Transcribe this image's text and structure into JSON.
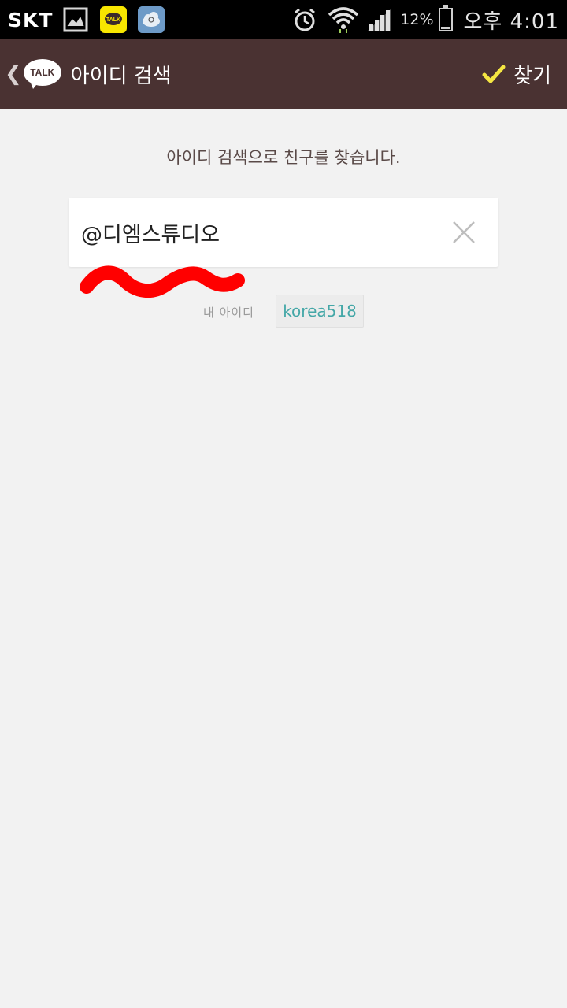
{
  "status_bar": {
    "carrier": "SKT",
    "battery_percent": "12%",
    "battery_level": 0.12,
    "time": "오후 4:01",
    "icons": [
      "gallery-icon",
      "kakaotalk-icon",
      "cloud-icon",
      "alarm-icon",
      "wifi-icon",
      "signal-icon",
      "battery-icon"
    ]
  },
  "header": {
    "logo_text": "TALK",
    "title": "아이디 검색",
    "find_label": "찾기",
    "accent": "#f5e642",
    "background": "#4a3232"
  },
  "main": {
    "guide_text": "아이디 검색으로 친구를 찾습니다.",
    "search": {
      "value": "@디엠스튜디오"
    },
    "my_id": {
      "label": "내 아이디",
      "value": "korea518",
      "value_color": "#44a7a7"
    },
    "annotation_color": "#ff0000"
  }
}
